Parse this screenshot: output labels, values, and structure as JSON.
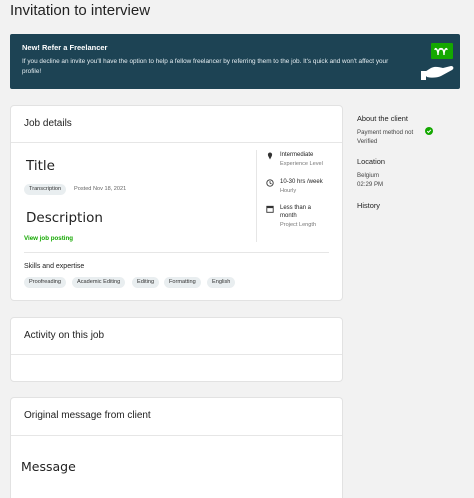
{
  "page": {
    "title": "Invitation to interview"
  },
  "banner": {
    "title": "New! Refer a Freelancer",
    "text": "If you decline an invite you'll have the option to help a fellow freelancer by referring them to the job. It's quick and won't affect your profile!",
    "colors": {
      "background": "#1d4354",
      "accent": "#14a800"
    }
  },
  "job_details": {
    "heading": "Job details",
    "title": "Title",
    "category": "Transcription",
    "posted": "Posted Nov 18, 2021",
    "description": "Description",
    "view_link": "View job posting",
    "meta": [
      {
        "icon": "experience-level-icon",
        "main": "Intermediate",
        "sub": "Experience Level"
      },
      {
        "icon": "clock-icon",
        "main": "10-30 hrs /week",
        "sub": "Hourly"
      },
      {
        "icon": "calendar-icon",
        "main": "Less than a month",
        "sub": "Project Length"
      }
    ],
    "skills_heading": "Skills and expertise",
    "skills": [
      "Proofreading",
      "Academic Editing",
      "Editing",
      "Formatting",
      "English"
    ]
  },
  "activity": {
    "heading": "Activity on this job"
  },
  "message": {
    "heading": "Original message from client",
    "body": "Message"
  },
  "client": {
    "heading": "About the client",
    "payment_method": "Payment method not Verified",
    "location_heading": "Location",
    "country": "Belgium",
    "local_time": "02:29 PM",
    "history_heading": "History"
  }
}
